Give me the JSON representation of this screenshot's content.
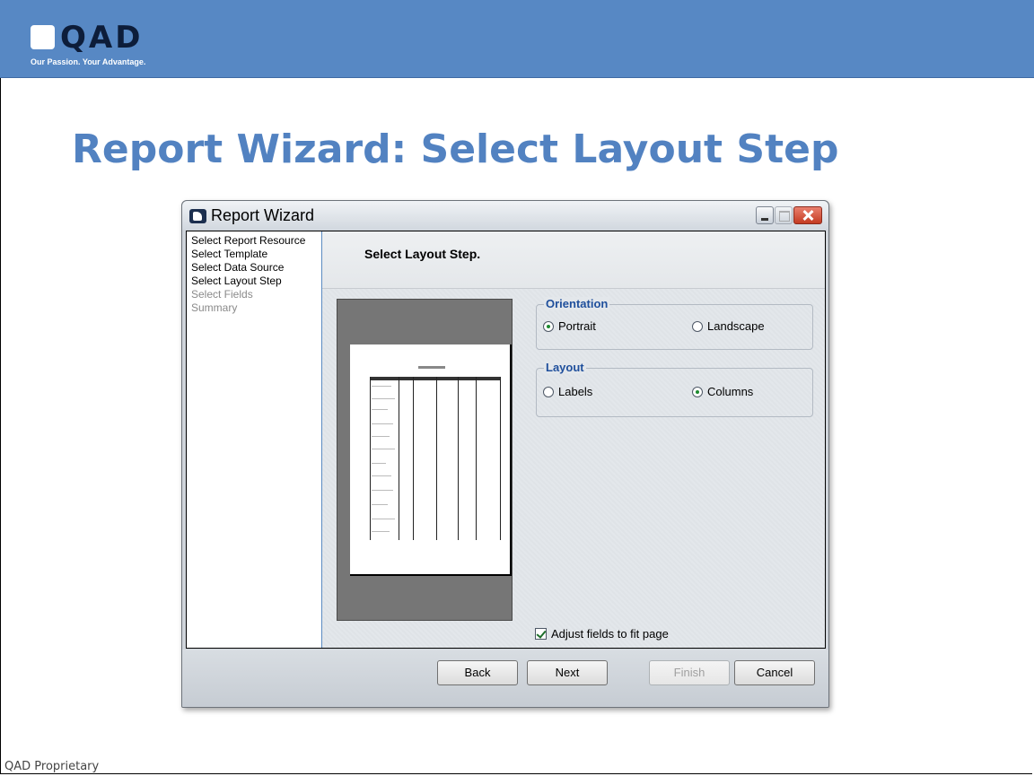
{
  "brand": {
    "logo_text": "QAD",
    "tagline": "Our Passion. Your Advantage.",
    "banner_color": "#5788c4"
  },
  "slide": {
    "title": "Report Wizard: Select Layout Step",
    "footer": "QAD Proprietary",
    "title_color": "#5282c1"
  },
  "window": {
    "title": "Report Wizard",
    "controls": [
      "minimize-icon",
      "maximize-icon",
      "close-icon"
    ]
  },
  "steps": [
    {
      "label": "Select Report Resource",
      "enabled": true
    },
    {
      "label": "Select Template",
      "enabled": true
    },
    {
      "label": "Select Data Source",
      "enabled": true
    },
    {
      "label": "Select Layout Step",
      "enabled": true
    },
    {
      "label": "Select Fields",
      "enabled": false
    },
    {
      "label": "Summary",
      "enabled": false
    }
  ],
  "header": {
    "title": "Select Layout Step."
  },
  "orientation": {
    "title": "Orientation",
    "options": [
      {
        "label": "Portrait",
        "selected": true
      },
      {
        "label": "Landscape",
        "selected": false
      }
    ]
  },
  "layout": {
    "title": "Layout",
    "options": [
      {
        "label": "Labels",
        "selected": false
      },
      {
        "label": "Columns",
        "selected": true
      }
    ]
  },
  "adjust": {
    "label": "Adjust fields to fit page",
    "checked": true
  },
  "buttons": {
    "back": "Back",
    "next": "Next",
    "finish": "Finish",
    "cancel": "Cancel"
  },
  "colors": {
    "group_title": "#1f4f9c",
    "radio_dot": "#1d8a2f"
  }
}
